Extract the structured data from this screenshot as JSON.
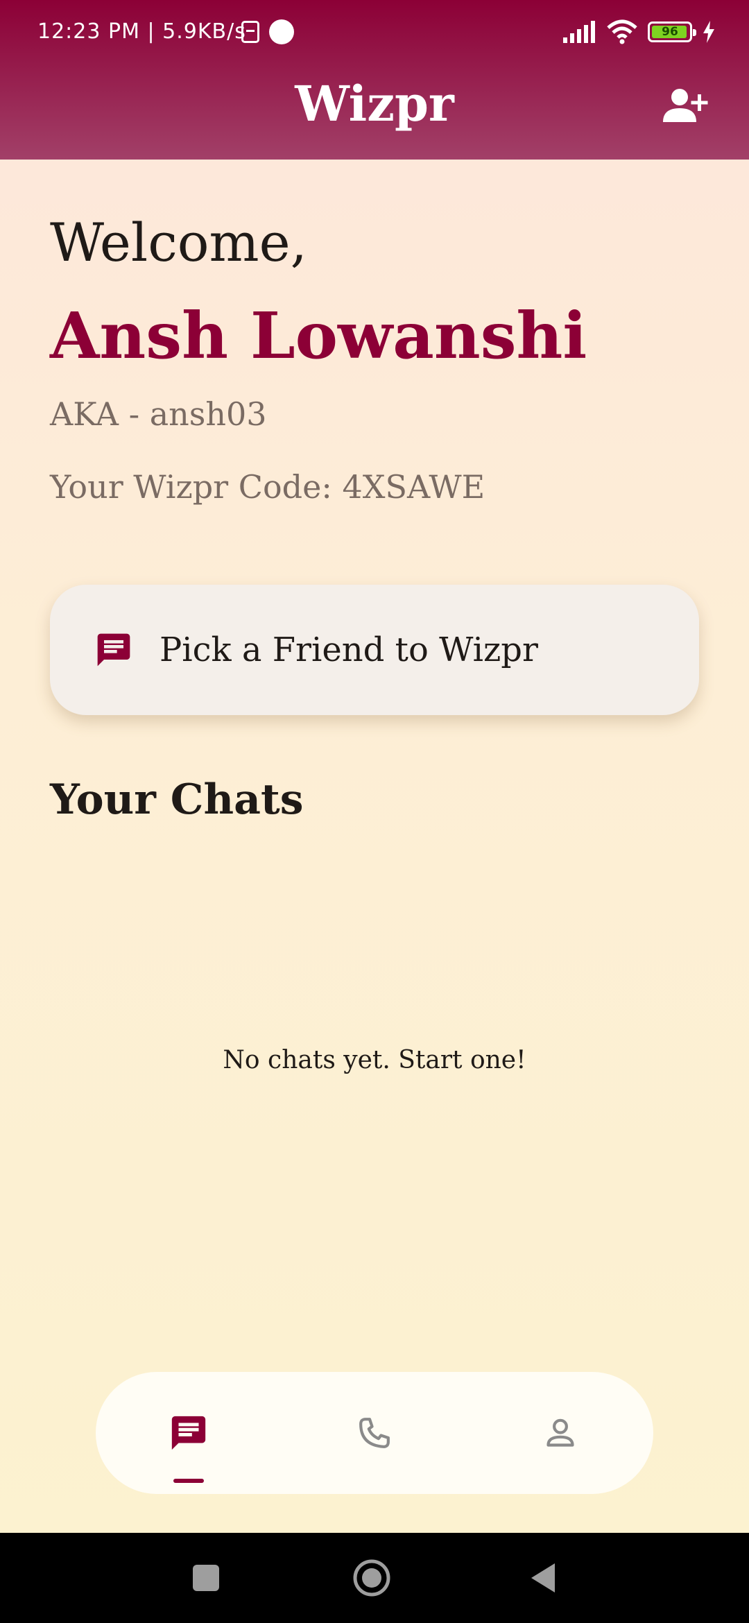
{
  "status_bar": {
    "time_speed": "12:23 PM | 5.9KB/s",
    "battery_level": "96",
    "battery_fraction": 0.96
  },
  "app_bar": {
    "title": "Wizpr",
    "add_friend_icon": "person-add-icon"
  },
  "welcome": {
    "greeting": "Welcome,",
    "name": "Ansh Lowanshi",
    "aka": "AKA - ansh03",
    "code": "Your Wizpr Code: 4XSAWE"
  },
  "pick_button": {
    "label": "Pick a Friend to Wizpr",
    "icon": "chat-icon"
  },
  "chats": {
    "heading": "Your Chats",
    "empty_message": "No chats yet. Start one!"
  },
  "bottom_nav": {
    "items": [
      {
        "icon": "chat-icon",
        "active": true
      },
      {
        "icon": "phone-icon",
        "active": false
      },
      {
        "icon": "profile-icon",
        "active": false
      }
    ]
  },
  "colors": {
    "brand": "#8c0036",
    "inactive_icon": "#8a8a8a"
  }
}
